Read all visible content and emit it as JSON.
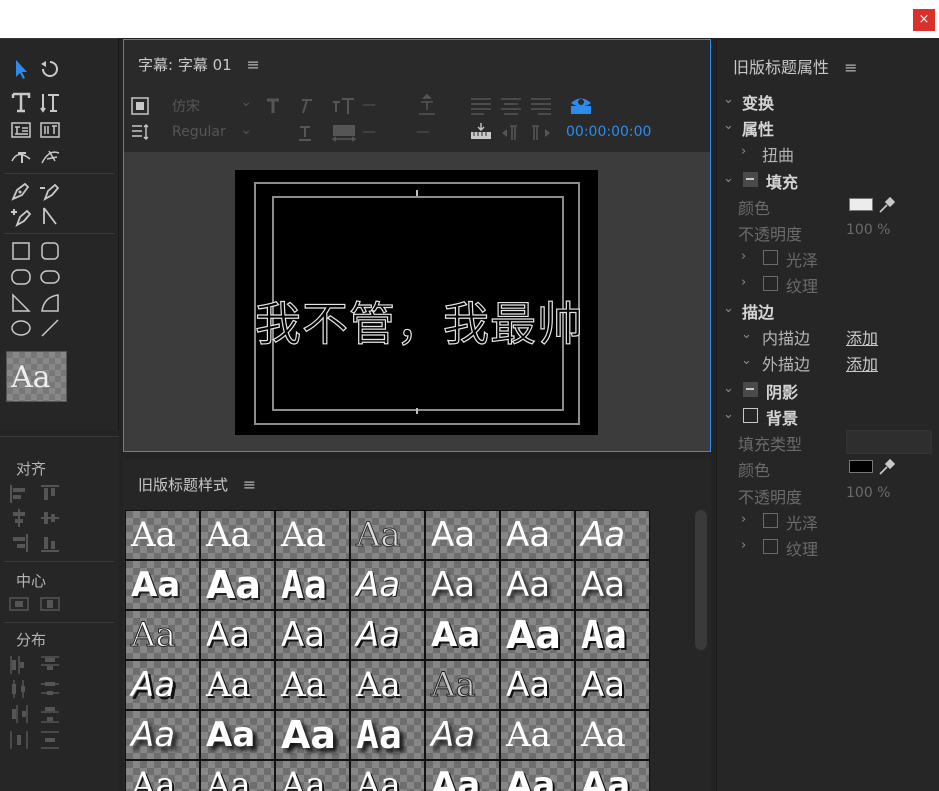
{
  "window": {
    "close_glyph": "×"
  },
  "tools": {
    "sample_label": "Aa"
  },
  "align": {
    "align_label": "对齐",
    "center_label": "中心",
    "distribute_label": "分布"
  },
  "editor": {
    "title": "字幕: 字幕 01",
    "font_family": "仿宋",
    "font_style": "Regular",
    "dash1": "—",
    "dash2": "—",
    "dash3": "—",
    "dash4": "—",
    "timecode": "00:00:00:00",
    "caption": "我不管，我最帅"
  },
  "styles": {
    "title": "旧版标题样式",
    "rows": [
      [
        "Aa",
        "Aa",
        "Aa",
        "Aa",
        "Aa",
        "Aa",
        "Aa"
      ],
      [
        "Aa",
        "Aa",
        "Aa",
        "Aa",
        "Aa",
        "Aa",
        "Aa"
      ],
      [
        "Aa",
        "Aa",
        "Aa",
        "Aa",
        "Aa",
        "Aa",
        "Aa"
      ],
      [
        "Aa",
        "Aa",
        "Aa",
        "Aa",
        "Aa",
        "Aa",
        "Aa"
      ],
      [
        "Aa",
        "Aa",
        "Aa",
        "Aa",
        "Aa",
        "Aa",
        "Aa"
      ],
      [
        "Aa",
        "Aa",
        "Aa",
        "Aa",
        "Aa",
        "Aa",
        "Aa"
      ]
    ]
  },
  "props": {
    "title": "旧版标题属性",
    "transform": "变换",
    "attributes": "属性",
    "distort": "扭曲",
    "fill": "填充",
    "color": "颜色",
    "opacity": "不透明度",
    "opacity_value": "100 %",
    "sheen": "光泽",
    "texture": "纹理",
    "stroke": "描边",
    "inner_stroke": "内描边",
    "outer_stroke": "外描边",
    "add": "添加",
    "add2": "添加",
    "shadow": "阴影",
    "background": "背景",
    "fill_type": "填充类型",
    "bg_color": "颜色",
    "bg_opacity": "不透明度",
    "bg_opacity_value": "100 %",
    "bg_sheen": "光泽",
    "bg_texture": "纹理",
    "fill_color": "#ececec",
    "bg_fill_color": "#000000"
  },
  "colors": {
    "accent": "#2d8ceb",
    "close": "#d9302c"
  }
}
